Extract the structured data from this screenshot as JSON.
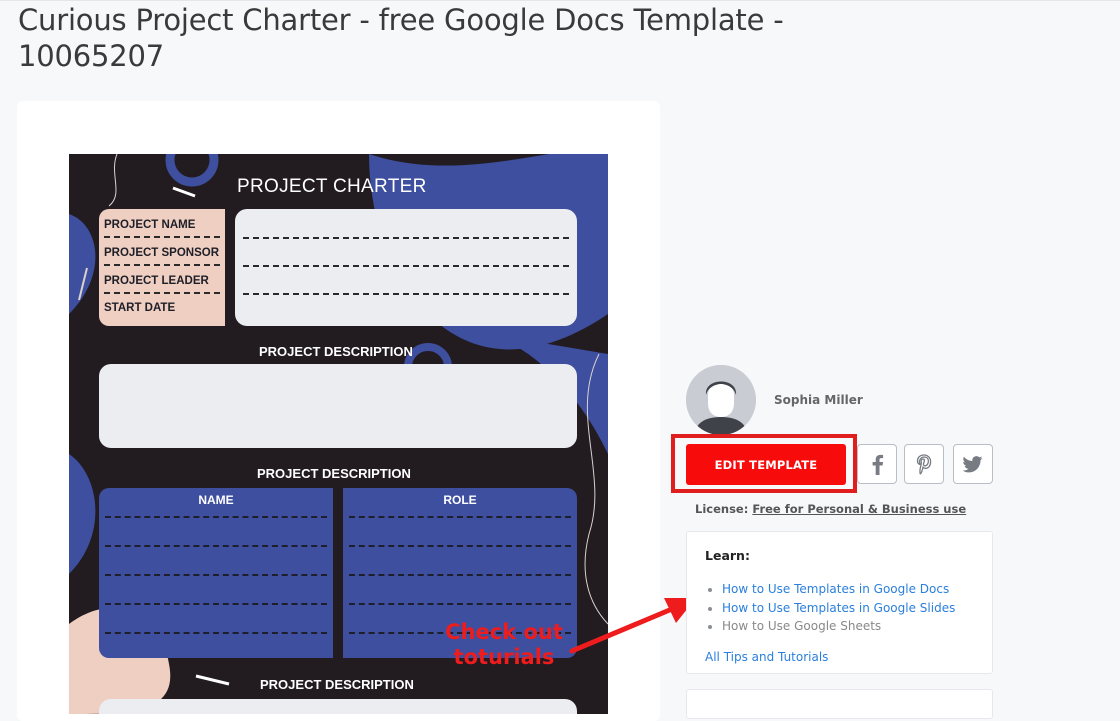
{
  "page": {
    "title": "Curious Project Charter - free Google Docs Template - 10065207"
  },
  "template_preview": {
    "heading": "PROJECT CHARTER",
    "info_labels": [
      "PROJECT NAME",
      "PROJECT SPONSOR",
      "PROJECT LEADER",
      "START DATE"
    ],
    "section_1": "PROJECT DESCRIPTION",
    "section_2": "PROJECT DESCRIPTION",
    "table_headers": {
      "name": "NAME",
      "role": "ROLE"
    },
    "section_3": "PROJECT DESCRIPTION"
  },
  "annotation": {
    "text": "Check out toturials",
    "color": "#ee1c1c"
  },
  "author": {
    "name": "Sophia Miller"
  },
  "actions": {
    "edit_label": "EDIT TEMPLATE",
    "share_icons": [
      "facebook-icon",
      "pinterest-icon",
      "twitter-icon"
    ]
  },
  "license": {
    "prefix": "License:",
    "link": "Free for Personal & Business use"
  },
  "learn": {
    "title": "Learn:",
    "items": [
      {
        "label": "How to Use Templates in Google Docs"
      },
      {
        "label": "How to Use Templates in Google Slides"
      },
      {
        "label": "How to Use Google Sheets"
      }
    ],
    "all_link": "All Tips and Tutorials"
  },
  "colors": {
    "edit_button": "#f80b0b",
    "highlight": "#e01e1e",
    "link": "#2a7fdc",
    "doc_background": "#221b20",
    "doc_blue": "#3d4f9e",
    "doc_peach": "#efcfc1"
  }
}
